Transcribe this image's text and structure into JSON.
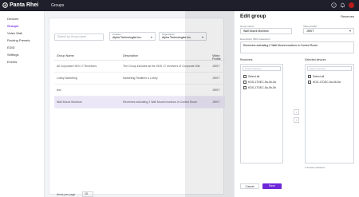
{
  "app": {
    "brand": "Panta Rhei",
    "page_title": "Groups"
  },
  "nav": {
    "items": [
      {
        "label": "Devices"
      },
      {
        "label": "Groups"
      },
      {
        "label": "Video Wall"
      },
      {
        "label": "Routing Presets"
      },
      {
        "label": "EDID"
      },
      {
        "label": "Settings"
      },
      {
        "label": "Events"
      }
    ]
  },
  "groups": {
    "search_placeholder": "Search by Group name",
    "filters": [
      {
        "label": "Location",
        "value": "Alpha Technologies Inc."
      },
      {
        "label": "Organization",
        "value": "Alpha Technologies Inc."
      }
    ],
    "columns": [
      "Group Name",
      "Description",
      "Video Profile"
    ],
    "rows": [
      {
        "name": "All Corporate HDS 17 Receivers",
        "description": "The Group includes all the HDS 17 receivers of Corporate Site",
        "profile": "JSKIT"
      },
      {
        "name": "Lobby Marketing",
        "description": "Marketing Realtime a Lobby",
        "profile": "JSKIT"
      },
      {
        "name": "test",
        "description": "",
        "profile": "JSKIT"
      },
      {
        "name": "Wall Mount Monitors",
        "description": "Receivers activating 2 Wall Mount monitors in Control Room",
        "profile": "JSKIT"
      }
    ],
    "pager_label": "Items per page",
    "pager_value": "10"
  },
  "edit_group": {
    "title": "Edit group",
    "reserves_label": "Reserves",
    "group_name_label": "Group name*",
    "group_name_value": "Wall Mount Monitors",
    "video_profile_label": "Video profile*",
    "video_profile_value": "JSKIT",
    "description_label": "Description (500 characters)",
    "description_value": "Receivers activating 2 Wall Mount monitors in Control Room",
    "receivers_label": "Receivers",
    "selected_label": "Selected devices",
    "search_placeholder": "Search devices",
    "available_items": [
      "Select all",
      "KDS-17DEC-5a-0b-0a",
      "KDS-17DEC-5a-0b-0b"
    ],
    "selected_items": [
      "Select all",
      "KDS-17DEC-5a-0b-5a"
    ],
    "arrow_right": "›",
    "arrow_left": "‹",
    "selected_count": "1 devices selected",
    "cancel_label": "Cancel",
    "save_label": "Save"
  },
  "colors": {
    "accent": "#6d28d9",
    "topbar": "#1f1f2b",
    "selected_row": "#ebe7f7"
  }
}
